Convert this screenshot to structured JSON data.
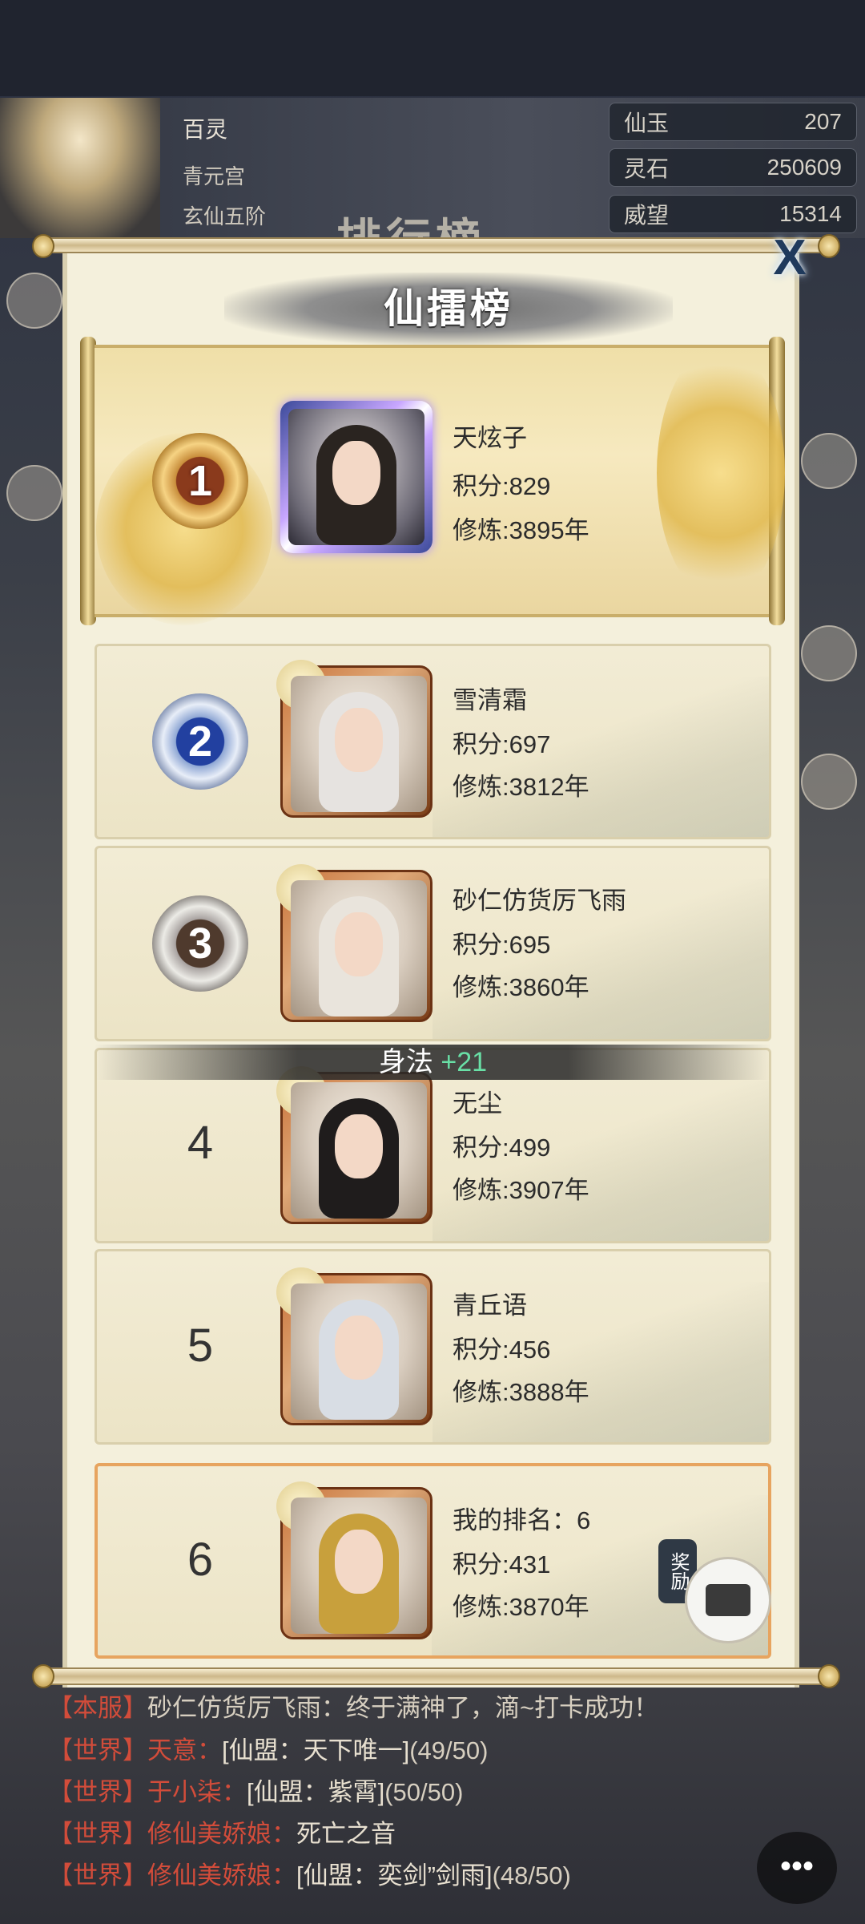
{
  "player": {
    "name": "百灵",
    "sect": "青元宫",
    "realm": "玄仙五阶"
  },
  "resources": [
    {
      "label": "仙玉",
      "value": "207"
    },
    {
      "label": "灵石",
      "value": "250609"
    },
    {
      "label": "威望",
      "value": "15314"
    }
  ],
  "background_title": "排行榜",
  "modal": {
    "title": "仙擂榜",
    "close": "X"
  },
  "ranking": [
    {
      "rank": "1",
      "name": "天炫子",
      "score": "积分:829",
      "cultivation": "修炼:3895年"
    },
    {
      "rank": "2",
      "name": "雪清霜",
      "score": "积分:697",
      "cultivation": "修炼:3812年"
    },
    {
      "rank": "3",
      "name": "砂仁仿货厉飞雨",
      "score": "积分:695",
      "cultivation": "修炼:3860年"
    },
    {
      "rank": "4",
      "name": "无尘",
      "score": "积分:499",
      "cultivation": "修炼:3907年"
    },
    {
      "rank": "5",
      "name": "青丘语",
      "score": "积分:456",
      "cultivation": "修炼:3888年"
    }
  ],
  "my_rank": {
    "rank": "6",
    "label": "我的排名：6",
    "score": "积分:431",
    "cultivation": "修炼:3870年",
    "reward": "奖励"
  },
  "attr_popup": {
    "label": "身法",
    "value": "+21"
  },
  "chat": [
    {
      "channel": "【本服】",
      "text": "砂仁仿货厉飞雨：终于满神了，滴~打卡成功！"
    },
    {
      "channel": "【世界】",
      "who": "天意：",
      "org": "[仙盟：天下唯一]",
      "extra": "(49/50)"
    },
    {
      "channel": "【世界】",
      "who": "于小柒：",
      "org": "[仙盟：紫霄]",
      "extra": "(50/50)"
    },
    {
      "channel": "【世界】",
      "who": "修仙美娇娘：",
      "org": "死亡之音",
      "extra": ""
    },
    {
      "channel": "【世界】",
      "who": "修仙美娇娘：",
      "org": "[仙盟：奕剑”剑雨]",
      "extra": "(48/50)"
    }
  ],
  "chat_icon": "chat-bubble-icon"
}
